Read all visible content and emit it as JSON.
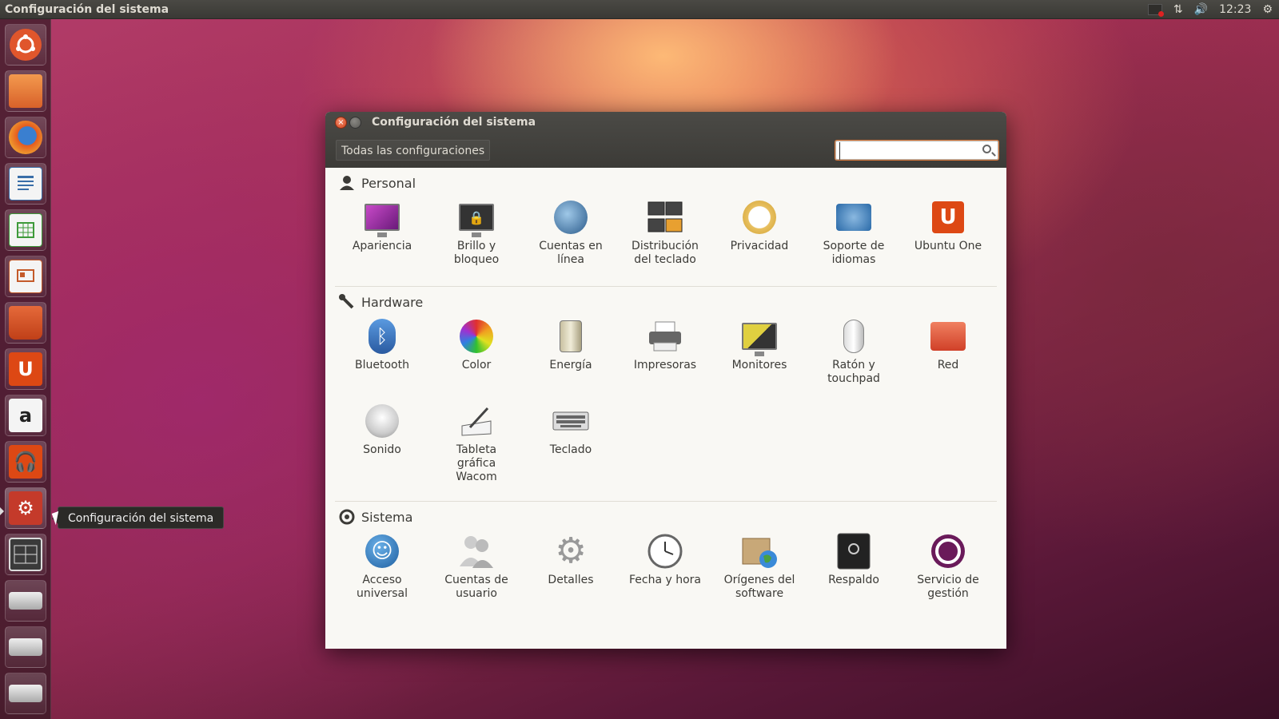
{
  "top_panel": {
    "title": "Configuración del sistema",
    "clock": "12:23"
  },
  "launcher": {
    "tooltip": "Configuración del sistema",
    "items": [
      {
        "name": "ubuntu-dash",
        "color": "#e0562c"
      },
      {
        "name": "files",
        "color": "#e9782f"
      },
      {
        "name": "firefox",
        "color": "#e55b1f"
      },
      {
        "name": "writer",
        "color": "#3a6ea8"
      },
      {
        "name": "calc",
        "color": "#3e9a3a"
      },
      {
        "name": "impress",
        "color": "#c45a2a"
      },
      {
        "name": "software-center",
        "color": "#d35a2a"
      },
      {
        "name": "ubuntu-one",
        "color": "#dd4814"
      },
      {
        "name": "amazon",
        "color": "#f0f0f0"
      },
      {
        "name": "ubuntu-one-music",
        "color": "#dd4814"
      },
      {
        "name": "system-settings",
        "color": "#c43a2a"
      },
      {
        "name": "workspace-switcher",
        "color": "#555"
      },
      {
        "name": "drive-1",
        "color": "#bbb"
      },
      {
        "name": "drive-2",
        "color": "#bbb"
      },
      {
        "name": "drive-3",
        "color": "#bbb"
      }
    ]
  },
  "window": {
    "title": "Configuración del sistema",
    "all_settings_label": "Todas las configuraciones",
    "search": {
      "value": "",
      "placeholder": ""
    }
  },
  "sections": {
    "personal": {
      "label": "Personal",
      "items": [
        "Apariencia",
        "Brillo y\nbloqueo",
        "Cuentas en\nlínea",
        "Distribución\ndel teclado",
        "Privacidad",
        "Soporte de\nidiomas",
        "Ubuntu One"
      ]
    },
    "hardware": {
      "label": "Hardware",
      "items": [
        "Bluetooth",
        "Color",
        "Energía",
        "Impresoras",
        "Monitores",
        "Ratón y\ntouchpad",
        "Red",
        "Sonido",
        "Tableta\ngráfica\nWacom",
        "Teclado"
      ]
    },
    "sistema": {
      "label": "Sistema",
      "items": [
        "Acceso\nuniversal",
        "Cuentas de\nusuario",
        "Detalles",
        "Fecha y hora",
        "Orígenes del\nsoftware",
        "Respaldo",
        "Servicio de\ngestión"
      ]
    }
  }
}
